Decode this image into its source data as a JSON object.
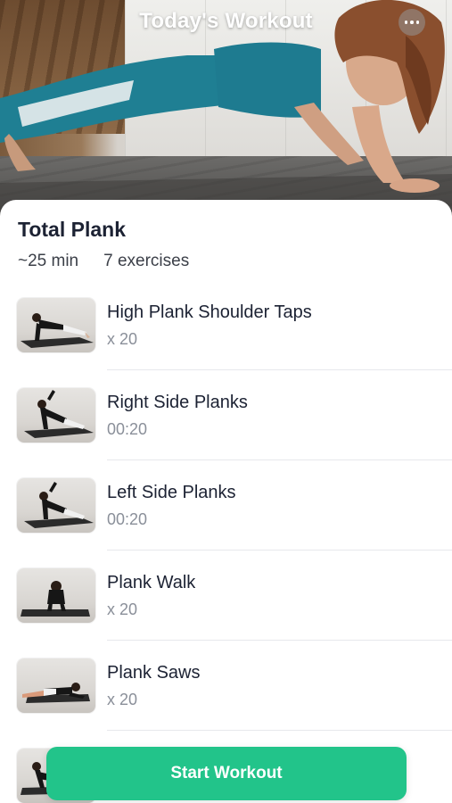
{
  "header": {
    "title": "Today's Workout",
    "more_icon": "more-horizontal-icon"
  },
  "plan": {
    "title": "Total Plank",
    "duration": "~25 min",
    "exercise_count": "7 exercises"
  },
  "exercises": [
    {
      "name": "High Plank Shoulder Taps",
      "detail": "x 20"
    },
    {
      "name": "Right Side Planks",
      "detail": "00:20"
    },
    {
      "name": "Left Side Planks",
      "detail": "00:20"
    },
    {
      "name": "Plank Walk",
      "detail": "x 20"
    },
    {
      "name": "Plank Saws",
      "detail": "x 20"
    },
    {
      "name": "",
      "detail": ""
    }
  ],
  "cta": {
    "label": "Start Workout"
  },
  "colors": {
    "accent": "#22c48a",
    "title_text": "#1c2233",
    "secondary_text": "#8a8f99",
    "divider": "#e7e8ec"
  }
}
